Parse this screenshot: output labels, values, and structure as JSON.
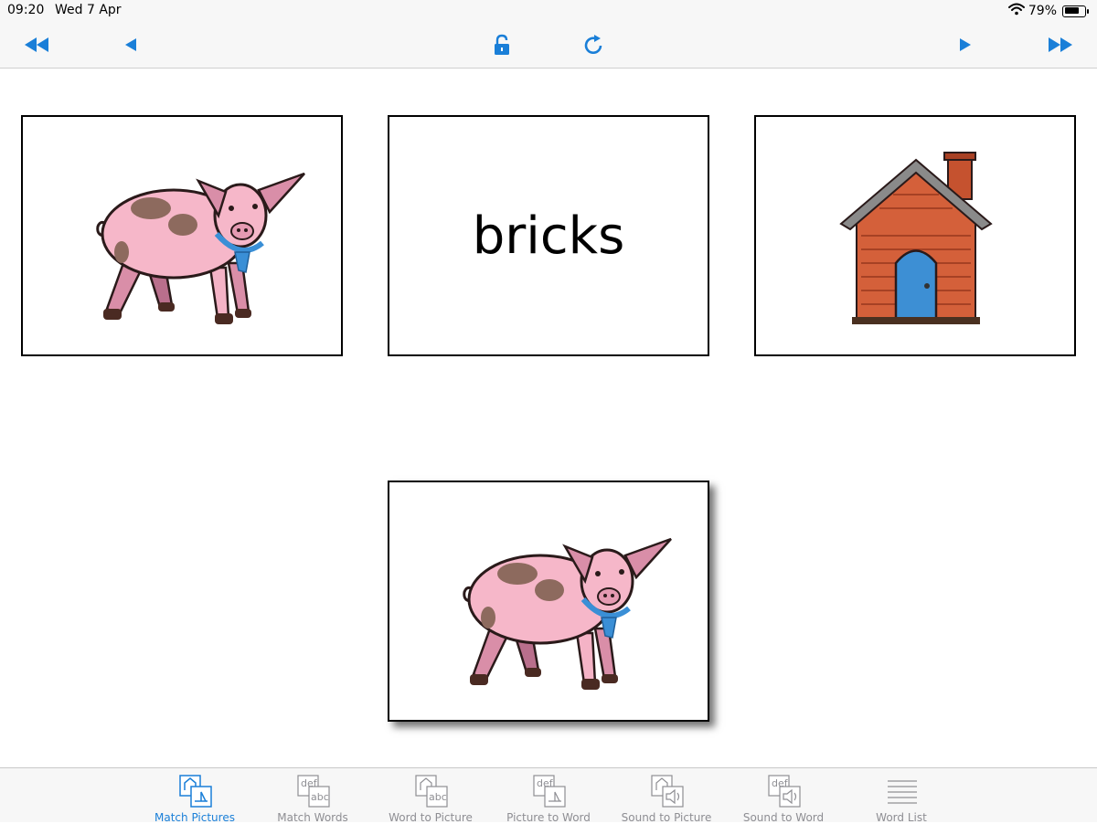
{
  "status_bar": {
    "time": "09:20",
    "date": "Wed 7 Apr",
    "battery": "79%",
    "battery_level": 0.79
  },
  "toolbar": {
    "buttons": [
      {
        "name": "first-button",
        "icon": "double-left-triangle-icon"
      },
      {
        "name": "previous-button",
        "icon": "left-triangle-icon"
      },
      {
        "name": "lock-button",
        "icon": "unlock-icon"
      },
      {
        "name": "refresh-button",
        "icon": "refresh-icon"
      },
      {
        "name": "next-button",
        "icon": "right-triangle-icon"
      },
      {
        "name": "last-button",
        "icon": "double-right-triangle-icon"
      }
    ],
    "accent_color": "#1a7fd8"
  },
  "cards": {
    "choice_1": {
      "type": "picture",
      "picture": "pig"
    },
    "choice_2": {
      "type": "word",
      "word": "bricks"
    },
    "choice_3": {
      "type": "picture",
      "picture": "brick-house"
    },
    "target": {
      "type": "picture",
      "picture": "pig"
    }
  },
  "tabbar": {
    "active": "Match Pictures",
    "tabs": [
      {
        "label": "Match Pictures",
        "icon": "match-pictures-icon"
      },
      {
        "label": "Match Words",
        "icon": "match-words-icon",
        "icon_text_top": "def",
        "icon_text_bottom": "abc"
      },
      {
        "label": "Word to Picture",
        "icon": "word-to-picture-icon",
        "icon_text_bottom": "abc"
      },
      {
        "label": "Picture to Word",
        "icon": "picture-to-word-icon",
        "icon_text_top": "def"
      },
      {
        "label": "Sound to Picture",
        "icon": "sound-to-picture-icon"
      },
      {
        "label": "Sound to Word",
        "icon": "sound-to-word-icon",
        "icon_text_top": "def"
      },
      {
        "label": "Word List",
        "icon": "word-list-icon"
      }
    ]
  }
}
